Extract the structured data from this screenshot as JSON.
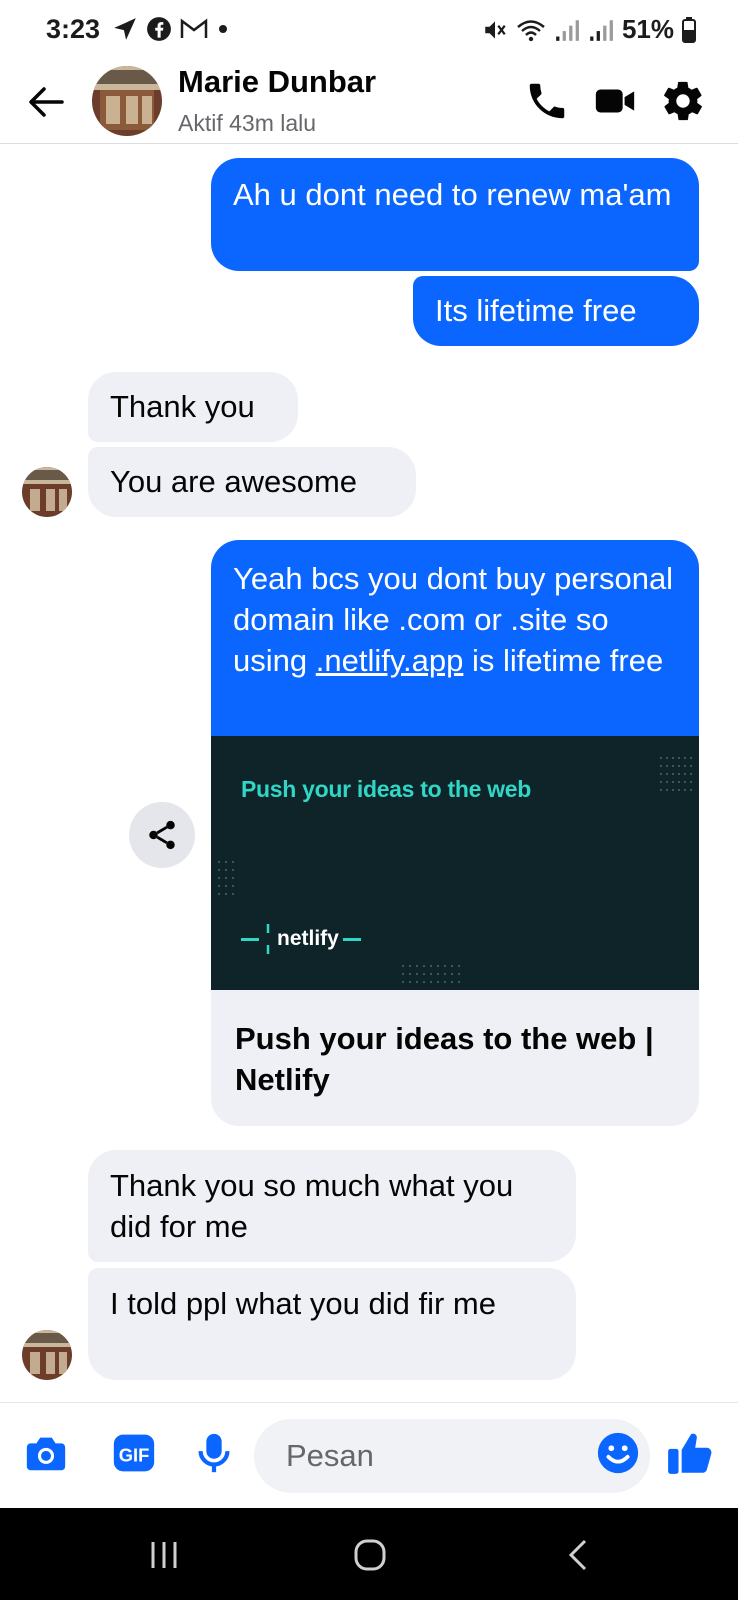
{
  "status_bar": {
    "time": "3:23",
    "battery_text": "51%",
    "icons": [
      "navigation-arrow-icon",
      "facebook-icon",
      "gmail-icon",
      "dot-icon",
      "mute-icon",
      "wifi-icon",
      "signal-icon",
      "signal-icon",
      "battery-icon"
    ]
  },
  "header": {
    "name": "Marie Dunbar",
    "status": "Aktif 43m lalu",
    "buttons": [
      "back-arrow-icon",
      "phone-icon",
      "video-icon",
      "gear-icon"
    ]
  },
  "messages": [
    {
      "direction": "outgoing",
      "text": "Ah u dont need to renew ma'am"
    },
    {
      "direction": "outgoing",
      "text": "Its lifetime free"
    },
    {
      "direction": "incoming",
      "text": "Thank you"
    },
    {
      "direction": "incoming",
      "text": "You are awesome"
    },
    {
      "direction": "incoming",
      "text": "Thank you so much what you did for me"
    },
    {
      "direction": "incoming",
      "text": "I told ppl what you did fir me"
    }
  ],
  "link_message": {
    "text_before": "Yeah bcs you dont buy personal domain like .com or .site so using ",
    "link_text": ".netlify.app",
    "text_after": " is lifetime free",
    "preview_image_title": "Push your ideas to the web",
    "preview_logo": "netlify",
    "preview_title": "Push your ideas to the web | Netlify"
  },
  "composer": {
    "placeholder": "Pesan",
    "icons": [
      "camera-icon",
      "gif-icon",
      "microphone-icon",
      "emoji-icon",
      "like-icon"
    ]
  },
  "colors": {
    "accent": "#0a66ff",
    "incoming_bubble": "#eff0f5",
    "preview_bg": "#0e2429",
    "preview_accent": "#30d6c6"
  }
}
